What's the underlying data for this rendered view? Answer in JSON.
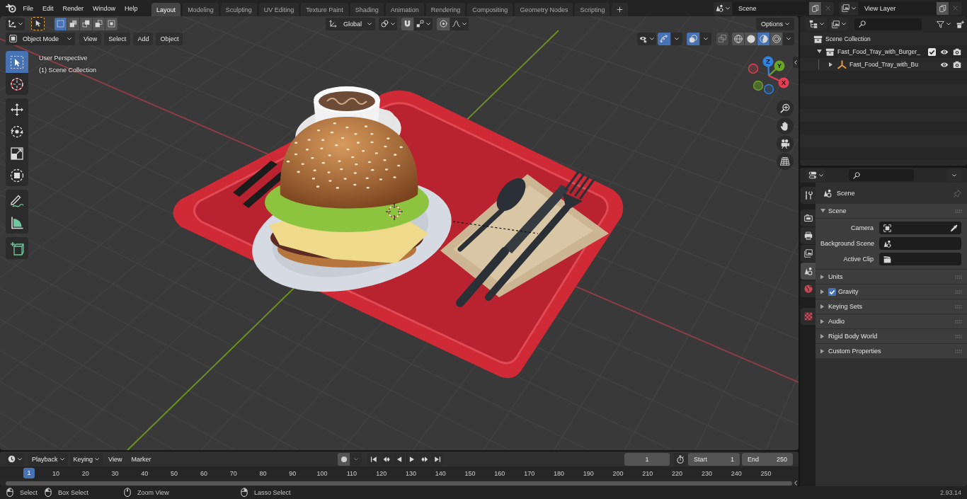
{
  "top_bar": {
    "menus": [
      "File",
      "Edit",
      "Render",
      "Window",
      "Help"
    ],
    "workspaces": [
      {
        "label": "Layout",
        "selected": true
      },
      {
        "label": "Modeling",
        "selected": false
      },
      {
        "label": "Sculpting",
        "selected": false
      },
      {
        "label": "UV Editing",
        "selected": false
      },
      {
        "label": "Texture Paint",
        "selected": false
      },
      {
        "label": "Shading",
        "selected": false
      },
      {
        "label": "Animation",
        "selected": false
      },
      {
        "label": "Rendering",
        "selected": false
      },
      {
        "label": "Compositing",
        "selected": false
      },
      {
        "label": "Geometry Nodes",
        "selected": false
      },
      {
        "label": "Scripting",
        "selected": false
      }
    ],
    "scene": "Scene",
    "view_layer": "View Layer"
  },
  "viewport": {
    "select_modes": [
      {
        "selected": true
      },
      {
        "selected": false
      },
      {
        "selected": false
      },
      {
        "selected": false
      },
      {
        "selected": false
      }
    ],
    "orientation": "Global",
    "snapping": {
      "on": false
    },
    "proportional_editing": {
      "on": false
    },
    "options": "Options",
    "mode": "Object Mode",
    "menus": [
      "View",
      "Select",
      "Add",
      "Object"
    ],
    "gizmos": {
      "on": true
    },
    "overlays": {
      "on": true
    },
    "xray": {
      "on": false
    },
    "shading_modes": [
      {
        "selected": false
      },
      {
        "selected": false
      },
      {
        "selected": true
      },
      {
        "selected": false
      }
    ],
    "info": [
      "User Perspective",
      "(1) Scene Collection"
    ],
    "tool_groups": [
      [
        {
          "selected": true
        },
        {
          "selected": false
        }
      ],
      [
        {
          "selected": false
        },
        {
          "selected": false
        },
        {
          "selected": false
        },
        {
          "selected": false
        }
      ],
      [
        {
          "selected": false
        },
        {
          "selected": false
        }
      ],
      [
        {
          "selected": false
        }
      ]
    ],
    "axis_gizmo": [
      {
        "label": "Z",
        "color": "#2f83e3"
      },
      {
        "label": "Y",
        "color": "#6ba524"
      },
      {
        "label": "X",
        "color": "#e93c55"
      }
    ]
  },
  "outliner": {
    "root": {
      "name": "Scene Collection",
      "kind": "scene_collection",
      "children": [
        {
          "name": "Fast_Food_Tray_with_Burger_",
          "kind": "collection",
          "expanded": true,
          "checked": true,
          "children": [
            {
              "name": "Fast_Food_Tray_with_Bu",
              "kind": "object",
              "expanded": false
            }
          ]
        }
      ]
    }
  },
  "properties": {
    "tabs": [
      {
        "selected": false
      },
      {
        "selected": false
      },
      {
        "selected": false
      },
      {
        "selected": false
      },
      {
        "selected": true
      },
      {
        "selected": false
      },
      {
        "selected": false
      }
    ],
    "context": "Scene",
    "panels": [
      {
        "title": "Scene",
        "expanded": true,
        "fields": [
          {
            "label": "Camera"
          },
          {
            "label": "Background Scene"
          },
          {
            "label": "Active Clip"
          }
        ]
      },
      {
        "title": "Units",
        "expanded": false
      },
      {
        "title": "Gravity",
        "expanded": false,
        "checkbox": {
          "checked": true
        }
      },
      {
        "title": "Keying Sets",
        "expanded": false
      },
      {
        "title": "Audio",
        "expanded": false
      },
      {
        "title": "Rigid Body World",
        "expanded": false
      },
      {
        "title": "Custom Properties",
        "expanded": false
      }
    ]
  },
  "timeline": {
    "menus": [
      {
        "label": "Playback",
        "kind": "dropdown"
      },
      {
        "label": "Keying",
        "kind": "dropdown"
      },
      {
        "label": "View",
        "kind": "menu"
      },
      {
        "label": "Marker",
        "kind": "menu"
      }
    ],
    "auto_keying": {
      "on": false
    },
    "current_frame": "1",
    "start": {
      "label": "Start",
      "value": "1"
    },
    "end": {
      "label": "End",
      "value": "250"
    },
    "playhead": "1",
    "frame_ticks": [
      "10",
      "20",
      "30",
      "40",
      "50",
      "60",
      "70",
      "80",
      "90",
      "100",
      "110",
      "120",
      "130",
      "140",
      "150",
      "160",
      "170",
      "180",
      "190",
      "200",
      "210",
      "220",
      "230",
      "240",
      "250"
    ]
  },
  "status_bar": {
    "hints": [
      "Select",
      "Box Select",
      "Zoom View",
      "Lasso Select"
    ],
    "version": "2.93.14"
  }
}
